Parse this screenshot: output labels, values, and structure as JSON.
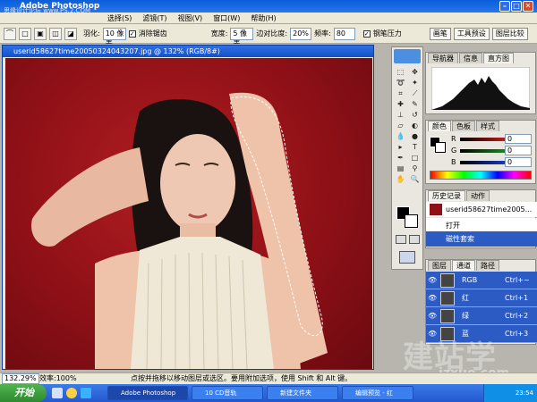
{
  "app": {
    "title": "Adobe Photoshop",
    "watermark": "思缘设计论坛 www.PS.2.COM"
  },
  "menubar": [
    "选择(S)",
    "滤镜(T)",
    "视图(V)",
    "窗口(W)",
    "帮助(H)"
  ],
  "options": {
    "feather_label": "羽化:",
    "feather_value": "10 像素",
    "antialias_label": "消除锯齿",
    "width_label": "宽度:",
    "width_value": "5 像素",
    "edge_contrast_label": "边对比度:",
    "edge_contrast_value": "20%",
    "frequency_label": "频率:",
    "frequency_value": "80",
    "pen_pressure_label": "钢笔压力",
    "workspace_buttons": [
      "画笔",
      "工具预设",
      "图层比较"
    ]
  },
  "document": {
    "title": "userid58627time20050324043207.jpg @ 132% (RGB/8#)"
  },
  "navigator": {
    "tabs": [
      "导航器",
      "信息",
      "直方图"
    ]
  },
  "color": {
    "tabs": [
      "颜色",
      "色板",
      "样式"
    ],
    "channels": [
      {
        "label": "R",
        "value": "0",
        "color": "#e02020"
      },
      {
        "label": "G",
        "value": "0",
        "color": "#20a020"
      },
      {
        "label": "B",
        "value": "0",
        "color": "#2040e0"
      }
    ]
  },
  "history": {
    "tabs": [
      "历史记录",
      "动作"
    ],
    "snapshot": "userid58627time2005...",
    "items": [
      {
        "label": "打开",
        "selected": false
      },
      {
        "label": "磁性套索",
        "selected": true
      }
    ]
  },
  "channels": {
    "tabs": [
      "图层",
      "通道",
      "路径"
    ],
    "rows": [
      {
        "name": "RGB",
        "shortcut": "Ctrl+~"
      },
      {
        "name": "红",
        "shortcut": "Ctrl+1"
      },
      {
        "name": "绿",
        "shortcut": "Ctrl+2"
      },
      {
        "name": "蓝",
        "shortcut": "Ctrl+3"
      }
    ]
  },
  "status": {
    "zoom": "132.29%",
    "efficiency": "效率:100%",
    "hint": "点按并拖移以移动图层或选区。要用附加选项，使用 Shift 和 Alt 键。"
  },
  "taskbar": {
    "start": "开始",
    "tasks": [
      {
        "label": "Adobe Photoshop",
        "active": true
      },
      {
        "label": "10 CD音轨",
        "active": false
      },
      {
        "label": "新建文件夹",
        "active": false
      },
      {
        "label": "编辑预览 - 红",
        "active": false
      }
    ],
    "clock": "23:54"
  },
  "site_watermark": {
    "text": "建站学",
    "url": "jzxue.com"
  }
}
